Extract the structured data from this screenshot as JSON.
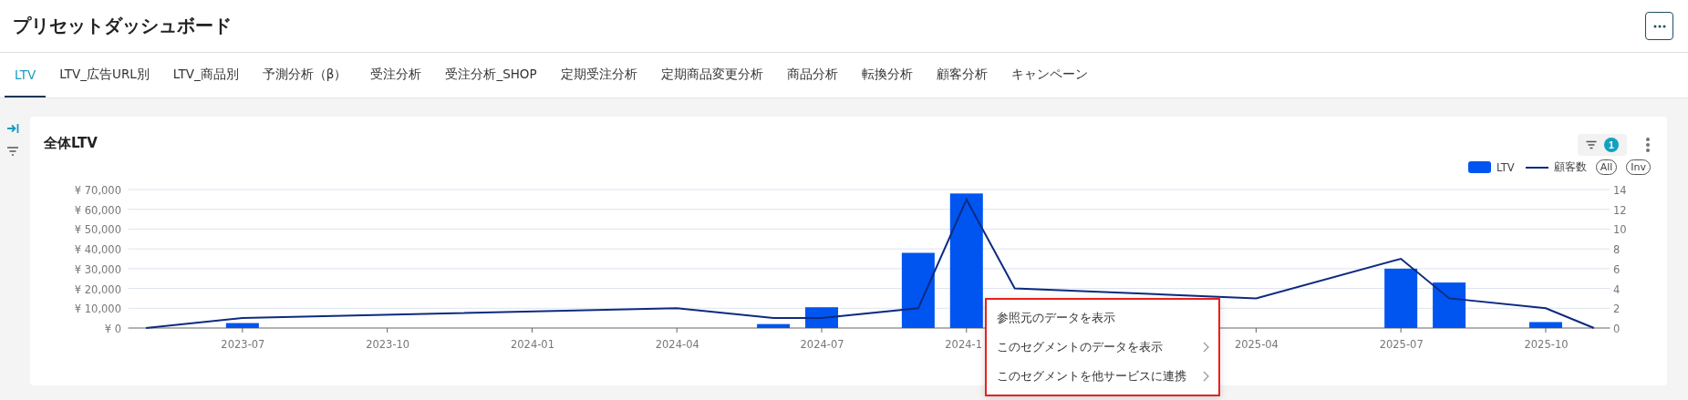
{
  "header": {
    "title": "プリセットダッシュボード"
  },
  "tabs": [
    {
      "label": "LTV",
      "selected": true
    },
    {
      "label": "LTV_広告URL別",
      "selected": false
    },
    {
      "label": "LTV_商品別",
      "selected": false
    },
    {
      "label": "予測分析（β）",
      "selected": false
    },
    {
      "label": "受注分析",
      "selected": false
    },
    {
      "label": "受注分析_SHOP",
      "selected": false
    },
    {
      "label": "定期受注分析",
      "selected": false
    },
    {
      "label": "定期商品変更分析",
      "selected": false
    },
    {
      "label": "商品分析",
      "selected": false
    },
    {
      "label": "転換分析",
      "selected": false
    },
    {
      "label": "顧客分析",
      "selected": false
    },
    {
      "label": "キャンペーン",
      "selected": false
    }
  ],
  "card": {
    "title": "全体LTV",
    "filter_count": "1",
    "legend_buttons": [
      "All",
      "Inv"
    ],
    "chart_data": {
      "type": "bar",
      "x": [
        "2023-05",
        "2023-07",
        "2024-04",
        "2024-06",
        "2024-07",
        "2024-09",
        "2024-10",
        "2024-11",
        "2025-04",
        "2025-07",
        "2025-08",
        "2025-10",
        "2025-11"
      ],
      "series": [
        {
          "name": "LTV",
          "type": "bar",
          "color": "#0055f0",
          "values": [
            null,
            2500,
            null,
            2000,
            10500,
            38000,
            68000,
            null,
            null,
            30000,
            23000,
            3000,
            null
          ]
        },
        {
          "name": "顧客数",
          "type": "line",
          "axis": "y2",
          "color": "#0c2a80",
          "values": [
            0,
            1,
            2,
            1,
            1,
            2,
            13,
            4,
            3,
            7,
            3,
            2,
            0
          ]
        }
      ],
      "ylim": [
        0,
        70000
      ],
      "yticks": [
        {
          "value": 0,
          "label": "¥ 0"
        },
        {
          "value": 10000,
          "label": "¥ 10,000"
        },
        {
          "value": 20000,
          "label": "¥ 20,000"
        },
        {
          "value": 30000,
          "label": "¥ 30,000"
        },
        {
          "value": 40000,
          "label": "¥ 40,000"
        },
        {
          "value": 50000,
          "label": "¥ 50,000"
        },
        {
          "value": 60000,
          "label": "¥ 60,000"
        },
        {
          "value": 70000,
          "label": "¥ 70,000"
        }
      ],
      "grid": true,
      "xlim": [
        "2023-04-20",
        "2025-11-11"
      ],
      "y2lim": [
        0,
        14
      ],
      "y2ticks": [
        0,
        2,
        4,
        6,
        8,
        10,
        12,
        14
      ],
      "xticks": [
        {
          "value": "2023-07",
          "label": "2023-07"
        },
        {
          "value": "2023-10",
          "label": "2023-10"
        },
        {
          "value": "2024-01",
          "label": "2024-01"
        },
        {
          "value": "2024-04",
          "label": "2024-04"
        },
        {
          "value": "2024-07",
          "label": "2024-07"
        },
        {
          "value": "2024-10",
          "label": "2024-1"
        },
        {
          "value": "2025-04",
          "label": "2025-04"
        },
        {
          "value": "2025-07",
          "label": "2025-07"
        },
        {
          "value": "2025-10",
          "label": "2025-10"
        }
      ]
    }
  },
  "context_menu": {
    "items": [
      {
        "label": "参照元のデータを表示",
        "has_submenu": false
      },
      {
        "label": "このセグメントのデータを表示",
        "has_submenu": true
      },
      {
        "label": "このセグメントを他サービスに連携",
        "has_submenu": true
      }
    ]
  }
}
